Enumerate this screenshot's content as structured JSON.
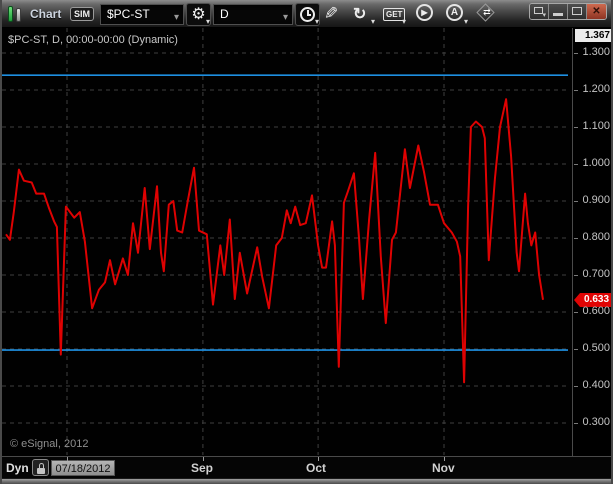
{
  "window": {
    "title": "Chart",
    "badge": "SIM",
    "symbol_value": "$PC-ST",
    "interval_value": "D",
    "get_label": "GET",
    "a_label": "A",
    "play_glyph": "▶",
    "controls": [
      "popout",
      "minimize",
      "maximize",
      "close"
    ],
    "close_glyph": "✕"
  },
  "chart": {
    "overlay_label": "$PC-ST, D, 00:00-00:00 (Dynamic)",
    "copyright": "© eSignal, 2012",
    "axis_max_label": "1.367",
    "last_price_label": "0.633",
    "colors": {
      "series": "#de0202",
      "band_lines": "#1e8fe1",
      "grid": "#3f3f3f",
      "last_price_bg": "#e00404",
      "axis_max_bg": "#ececec"
    }
  },
  "bottom_bar": {
    "mode_label": "Dyn",
    "start_date_label": "07/18/2012"
  },
  "chart_data": {
    "type": "line",
    "title": "$PC-ST, D, 00:00-00:00 (Dynamic)",
    "x_start_date": "07/18/2012",
    "x_unit": "trading days since start date",
    "y_axis_top": 1.367,
    "last_value": 0.633,
    "y_ticks": [
      1.3,
      1.2,
      1.1,
      1.0,
      0.9,
      0.8,
      0.7,
      0.6,
      0.5,
      0.4,
      0.3
    ],
    "h_lines": [
      {
        "value": 1.24,
        "style": "solid"
      },
      {
        "value": 0.497,
        "style": "solid"
      }
    ],
    "x_gridlines": [
      {
        "label": "",
        "day": 10.9
      },
      {
        "label": "Sep",
        "day": 35.2
      },
      {
        "label": "Oct",
        "day": 55.8
      },
      {
        "label": "Nov",
        "day": 78.3
      }
    ],
    "grid": "dashed",
    "legend": "none",
    "series": [
      {
        "name": "$PC-ST",
        "points": [
          [
            0,
            0.81
          ],
          [
            0.7,
            0.795
          ],
          [
            1.4,
            0.87
          ],
          [
            2.3,
            0.985
          ],
          [
            3.2,
            0.955
          ],
          [
            4.6,
            0.95
          ],
          [
            5.4,
            0.92
          ],
          [
            6.8,
            0.92
          ],
          [
            7.7,
            0.88
          ],
          [
            8.6,
            0.845
          ],
          [
            9.1,
            0.83
          ],
          [
            9.8,
            0.485
          ],
          [
            10.7,
            0.885
          ],
          [
            12.2,
            0.855
          ],
          [
            13.2,
            0.87
          ],
          [
            14.1,
            0.79
          ],
          [
            15.4,
            0.61
          ],
          [
            16.6,
            0.66
          ],
          [
            17.7,
            0.68
          ],
          [
            18.6,
            0.74
          ],
          [
            19.5,
            0.675
          ],
          [
            20.9,
            0.745
          ],
          [
            21.8,
            0.7
          ],
          [
            22.7,
            0.84
          ],
          [
            23.6,
            0.76
          ],
          [
            24.8,
            0.935
          ],
          [
            25.7,
            0.77
          ],
          [
            27.0,
            0.94
          ],
          [
            27.7,
            0.76
          ],
          [
            28.2,
            0.71
          ],
          [
            29.1,
            0.89
          ],
          [
            29.9,
            0.9
          ],
          [
            30.6,
            0.82
          ],
          [
            31.5,
            0.815
          ],
          [
            32.5,
            0.9
          ],
          [
            33.6,
            0.99
          ],
          [
            34.5,
            0.82
          ],
          [
            35.9,
            0.81
          ],
          [
            37.0,
            0.62
          ],
          [
            38.3,
            0.78
          ],
          [
            39.0,
            0.7
          ],
          [
            40.0,
            0.85
          ],
          [
            40.9,
            0.635
          ],
          [
            41.8,
            0.76
          ],
          [
            43.1,
            0.65
          ],
          [
            44.9,
            0.775
          ],
          [
            45.8,
            0.695
          ],
          [
            47.0,
            0.61
          ],
          [
            48.3,
            0.78
          ],
          [
            49.3,
            0.8
          ],
          [
            50.2,
            0.875
          ],
          [
            50.9,
            0.84
          ],
          [
            51.7,
            0.885
          ],
          [
            52.6,
            0.835
          ],
          [
            53.6,
            0.84
          ],
          [
            54.7,
            0.915
          ],
          [
            55.8,
            0.78
          ],
          [
            56.5,
            0.72
          ],
          [
            57.2,
            0.72
          ],
          [
            58.3,
            0.845
          ],
          [
            58.8,
            0.78
          ],
          [
            59.5,
            0.452
          ],
          [
            60.4,
            0.895
          ],
          [
            61.1,
            0.925
          ],
          [
            62.2,
            0.975
          ],
          [
            63.1,
            0.8
          ],
          [
            63.8,
            0.635
          ],
          [
            64.9,
            0.85
          ],
          [
            66.0,
            1.03
          ],
          [
            67.0,
            0.75
          ],
          [
            67.9,
            0.57
          ],
          [
            69.0,
            0.795
          ],
          [
            69.7,
            0.815
          ],
          [
            71.3,
            1.04
          ],
          [
            72.2,
            0.935
          ],
          [
            73.7,
            1.05
          ],
          [
            74.7,
            0.98
          ],
          [
            75.8,
            0.89
          ],
          [
            77.2,
            0.89
          ],
          [
            78.3,
            0.84
          ],
          [
            79.7,
            0.815
          ],
          [
            80.6,
            0.79
          ],
          [
            81.2,
            0.75
          ],
          [
            81.9,
            0.41
          ],
          [
            82.6,
            0.885
          ],
          [
            83.1,
            1.1
          ],
          [
            84.0,
            1.115
          ],
          [
            85.1,
            1.1
          ],
          [
            85.6,
            1.07
          ],
          [
            86.3,
            0.74
          ],
          [
            87.4,
            0.96
          ],
          [
            88.3,
            1.1
          ],
          [
            89.4,
            1.175
          ],
          [
            90.3,
            1.02
          ],
          [
            91.3,
            0.76
          ],
          [
            91.7,
            0.71
          ],
          [
            92.8,
            0.92
          ],
          [
            93.3,
            0.84
          ],
          [
            93.9,
            0.78
          ],
          [
            94.6,
            0.815
          ],
          [
            95.3,
            0.7
          ],
          [
            96.0,
            0.633
          ]
        ]
      }
    ]
  }
}
